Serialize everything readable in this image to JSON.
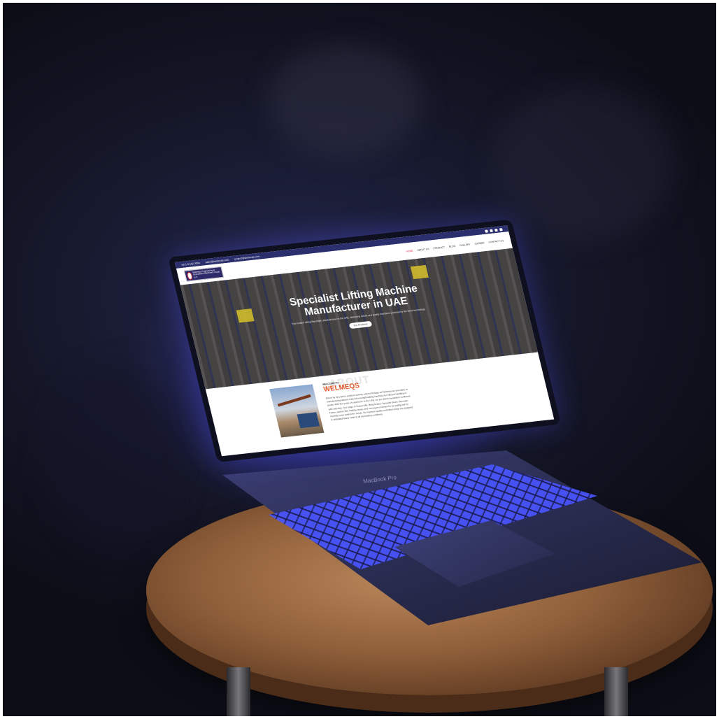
{
  "photo": {
    "subject": "",
    "laptop_model": "MacBook Pro"
  },
  "website": {
    "topbar": {
      "phone": "+971 6 542 3004",
      "email": "sales@welmeqs.com",
      "email2": "project@welmeqs.com"
    },
    "logo_text": "Welmeqs Engineering & Specialised Machinery Equip. LLC",
    "nav": [
      {
        "label": "HOME",
        "active": true
      },
      {
        "label": "ABOUT US"
      },
      {
        "label": "PRODUCT"
      },
      {
        "label": "BLOG"
      },
      {
        "label": "GALLERY"
      },
      {
        "label": "CAREER"
      },
      {
        "label": "CONTACT US"
      }
    ],
    "hero": {
      "title": "Specialist Lifting Machine Manufacturer in UAE",
      "subtitle": "Your trusted Lifting Machinery Manufacturer in the UAE, delivering robust and quality machines powered by the latest technology.",
      "button": "Our Products"
    },
    "about": {
      "ghost": "ABOUT",
      "welcome": "WELCOME TO",
      "brand": "WELMEQS",
      "paragraph": "Driven by innovation, problem-solving, and technology, at Welmeqs we specialise in manufacturing tailored material moving/handling machines for efficient handling of goods. With five years of experience in the UAE, we are driven by passion combined with expertise. Our range of Scissor lifts, lifting beams, Spreader Beam, Spreader Frame, stacker lifts, loading ramps, and conveyors is known for its quality and for meeting every customer's needs. Our rigorous quality-controlled ramps are designed to withstand heavy loads in all demanding conditions."
    }
  },
  "colors": {
    "topbar": "#2b2f6e",
    "accent_nav": "#e5355a",
    "brand_orange": "#e2572a"
  }
}
